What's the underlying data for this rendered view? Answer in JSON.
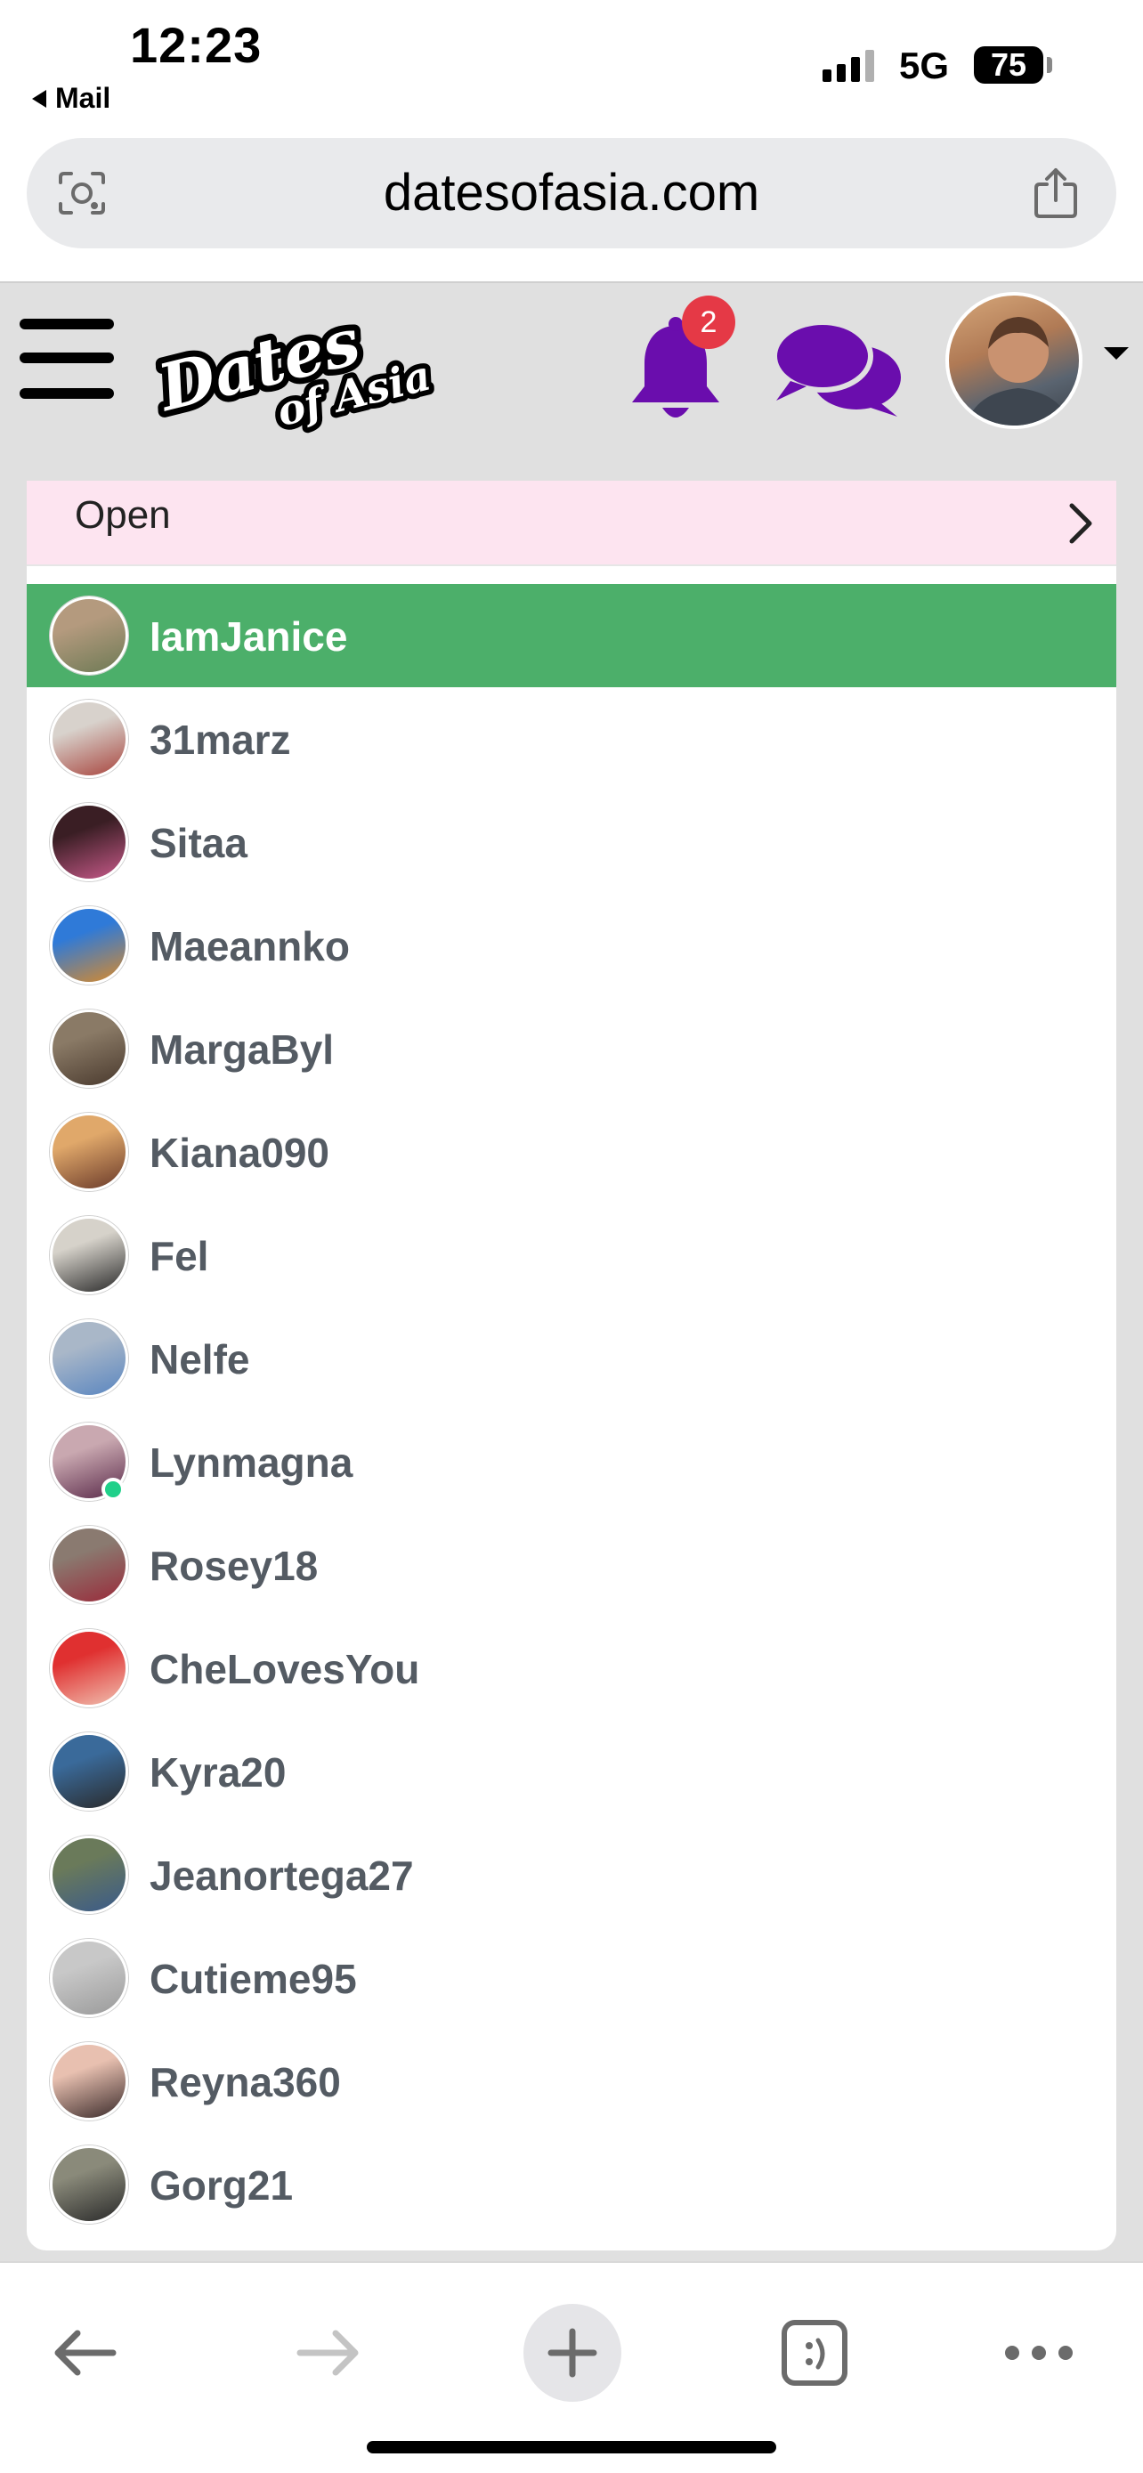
{
  "status_bar": {
    "time": "12:23",
    "back_app": "Mail",
    "network": "5G",
    "battery": "75"
  },
  "browser": {
    "url": "datesofasia.com",
    "icons": [
      "visual-search-icon",
      "share-icon"
    ]
  },
  "site": {
    "logo_text": "Dates of Asia",
    "notification_count": "2",
    "colors": {
      "header_bg": "#e0e0e0",
      "icon_purple": "#6a0dad",
      "badge": "#e53946",
      "active_row": "#4caf6a",
      "panel_head": "#fde4f0"
    }
  },
  "panel": {
    "header_label": "Open",
    "users": [
      {
        "name": "IamJanice",
        "active": true,
        "online": false,
        "avatar": [
          "#b49a7e",
          "#6e7a55"
        ]
      },
      {
        "name": "31marz",
        "active": false,
        "online": false,
        "avatar": [
          "#d8d2cc",
          "#a8453e"
        ]
      },
      {
        "name": "Sitaa",
        "active": false,
        "online": false,
        "avatar": [
          "#3a1e24",
          "#c85a8a"
        ]
      },
      {
        "name": "Maeannko",
        "active": false,
        "online": false,
        "avatar": [
          "#2f7ad8",
          "#d98a2a"
        ]
      },
      {
        "name": "MargaByl",
        "active": false,
        "online": false,
        "avatar": [
          "#8a7a66",
          "#4a3a2e"
        ]
      },
      {
        "name": "Kiana090",
        "active": false,
        "online": false,
        "avatar": [
          "#e0a86a",
          "#6a3a2a"
        ]
      },
      {
        "name": "Fel",
        "active": false,
        "online": false,
        "avatar": [
          "#d6d2ca",
          "#2a2a2a"
        ]
      },
      {
        "name": "Nelfe",
        "active": false,
        "online": false,
        "avatar": [
          "#a9b7c8",
          "#5a86c0"
        ]
      },
      {
        "name": "Lynmagna",
        "active": false,
        "online": true,
        "avatar": [
          "#c9a8b0",
          "#5a2a4a"
        ]
      },
      {
        "name": "Rosey18",
        "active": false,
        "online": false,
        "avatar": [
          "#8a7a70",
          "#9a2a3a"
        ]
      },
      {
        "name": "CheLovesYou",
        "active": false,
        "online": false,
        "avatar": [
          "#e03030",
          "#f0c0b0"
        ]
      },
      {
        "name": "Kyra20",
        "active": false,
        "online": false,
        "avatar": [
          "#3a6a9a",
          "#2a2a2a"
        ]
      },
      {
        "name": "Jeanortega27",
        "active": false,
        "online": false,
        "avatar": [
          "#6a7a5a",
          "#3a5a8a"
        ]
      },
      {
        "name": "Cutieme95",
        "active": false,
        "online": false,
        "avatar": [
          "#c8c8c8",
          "#9a9a9a"
        ]
      },
      {
        "name": "Reyna360",
        "active": false,
        "online": false,
        "avatar": [
          "#e8c0b0",
          "#3a2a2a"
        ]
      },
      {
        "name": "Gorg21",
        "active": false,
        "online": false,
        "avatar": [
          "#8a8a7a",
          "#2a2a2a"
        ]
      }
    ]
  },
  "toolbar": {
    "icons": [
      "back-arrow-icon",
      "forward-arrow-icon",
      "new-tab-plus-icon",
      "tabs-icon",
      "more-icon"
    ]
  }
}
